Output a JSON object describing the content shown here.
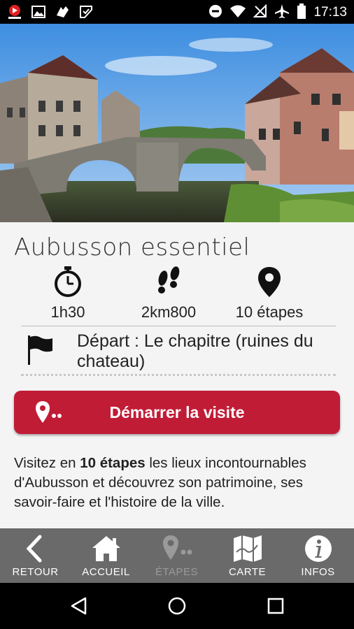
{
  "status_bar": {
    "time": "17:13",
    "notification_icons": [
      "video-app-icon",
      "image-icon",
      "sport-shoe-icon",
      "check-tag-icon"
    ],
    "system_icons": [
      "do-not-disturb-icon",
      "wifi-icon",
      "sim-off-icon",
      "airplane-icon",
      "battery-icon"
    ]
  },
  "hero": {
    "image": "Aubusson stone bridge over river with old houses"
  },
  "tour": {
    "title": "Aubusson essentiel",
    "duration": "1h30",
    "distance": "2km800",
    "steps": "10 étapes",
    "depart": "Départ : Le chapitre (ruines du chateau)",
    "start_button": "Démarrer la visite",
    "description_pre": "Visitez en ",
    "description_bold": "10 étapes",
    "description_post": " les lieux incontournables d'Aubusson et découvrez son patrimoine, ses savoir-faire et l'histoire de la ville."
  },
  "nav": {
    "items": [
      {
        "label": "RETOUR",
        "icon": "back-chevron-icon"
      },
      {
        "label": "ACCUEIL",
        "icon": "home-icon"
      },
      {
        "label": "ÉTAPES",
        "icon": "location-dots-icon",
        "disabled": true
      },
      {
        "label": "CARTE",
        "icon": "map-icon"
      },
      {
        "label": "INFOS",
        "icon": "info-icon"
      }
    ]
  },
  "colors": {
    "accent": "#c11c36",
    "nav_bg": "#6a6a6a",
    "status_bg": "#000000"
  }
}
